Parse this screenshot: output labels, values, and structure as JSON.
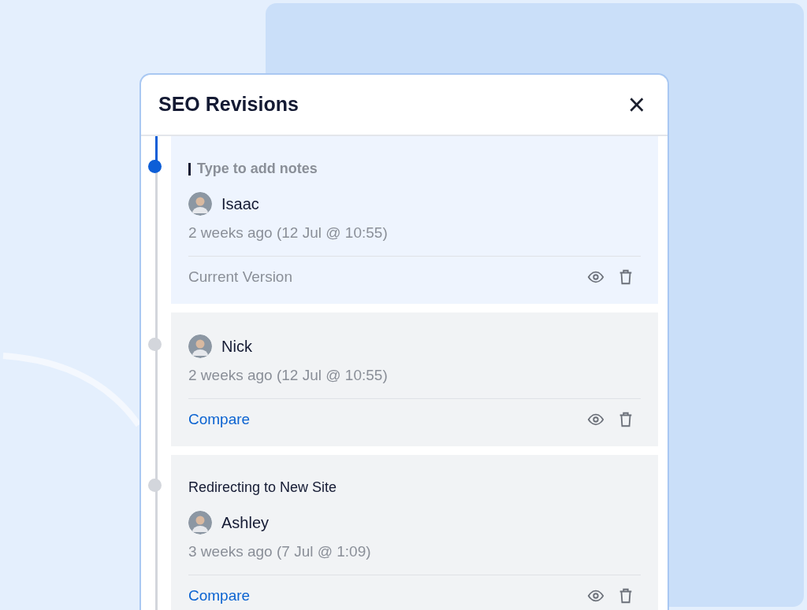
{
  "dialog": {
    "title": "SEO Revisions",
    "close": "×"
  },
  "revisions": [
    {
      "selected": true,
      "note": {
        "kind": "field",
        "placeholder": "Type to add notes"
      },
      "author": "Isaac",
      "time": "2 weeks ago (12 Jul @ 10:55)",
      "footer": {
        "kind": "status",
        "text": "Current Version"
      }
    },
    {
      "selected": false,
      "author": "Nick",
      "time": "2 weeks ago (12 Jul @ 10:55)",
      "footer": {
        "kind": "link",
        "text": "Compare"
      }
    },
    {
      "selected": false,
      "note": {
        "kind": "text",
        "text": "Redirecting to New Site"
      },
      "author": "Ashley",
      "time": "3 weeks ago (7 Jul @ 1:09)",
      "footer": {
        "kind": "link",
        "text": "Compare"
      }
    }
  ]
}
